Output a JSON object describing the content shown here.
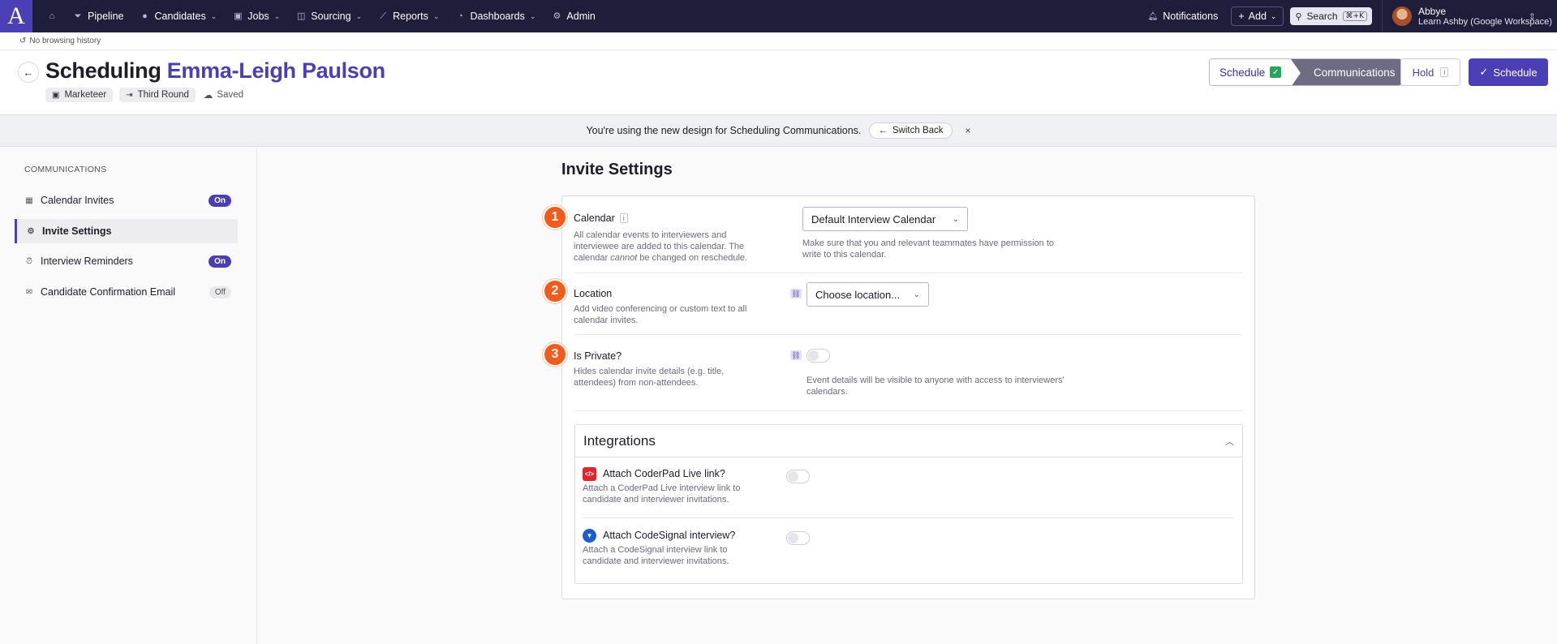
{
  "nav": {
    "logo": "A",
    "items": [
      {
        "label": "Pipeline",
        "chev": false
      },
      {
        "label": "Candidates",
        "chev": true
      },
      {
        "label": "Jobs",
        "chev": true
      },
      {
        "label": "Sourcing",
        "chev": true
      },
      {
        "label": "Reports",
        "chev": true
      },
      {
        "label": "Dashboards",
        "chev": true
      },
      {
        "label": "Admin",
        "chev": false
      }
    ],
    "notifications": "Notifications",
    "add": "Add",
    "search": "Search",
    "search_shortcut": "⌘+K",
    "user_name": "Abbye",
    "user_org": "Learn Ashby (Google Workspace)"
  },
  "history": "No browsing history",
  "header": {
    "title_prefix": "Scheduling",
    "candidate": "Emma-Leigh Paulson",
    "tag_job": "Marketeer",
    "tag_stage": "Third Round",
    "saved": "Saved",
    "step_schedule": "Schedule",
    "step_communications": "Communications",
    "hold": "Hold",
    "hold_info": "i",
    "schedule_button": "Schedule"
  },
  "banner": {
    "text": "You're using the new design for Scheduling Communications.",
    "switch_back": "Switch Back",
    "close": "×"
  },
  "sidebar": {
    "title": "COMMUNICATIONS",
    "items": [
      {
        "label": "Calendar Invites",
        "status": "On"
      },
      {
        "label": "Invite Settings",
        "status": ""
      },
      {
        "label": "Interview Reminders",
        "status": "On"
      },
      {
        "label": "Candidate Confirmation Email",
        "status": "Off"
      }
    ]
  },
  "main": {
    "title": "Invite Settings",
    "calendar": {
      "num": "1",
      "label": "Calendar",
      "info": "i",
      "desc_1": "All calendar events to interviewers and interviewee are added to this calendar. The calendar ",
      "desc_em": "cannot",
      "desc_2": " be changed on reschedule.",
      "value": "Default Interview Calendar",
      "hint": "Make sure that you and relevant teammates have permission to write to this calendar."
    },
    "location": {
      "num": "2",
      "label": "Location",
      "desc": "Add video conferencing or custom text to all calendar invites.",
      "placeholder": "Choose location..."
    },
    "private": {
      "num": "3",
      "label": "Is Private?",
      "desc": "Hides calendar invite details (e.g. title, attendees) from non-attendees.",
      "hint": "Event details will be visible to anyone with access to interviewers' calendars."
    },
    "integrations": {
      "title": "Integrations",
      "coderpad_label": "Attach CoderPad Live link?",
      "coderpad_desc": "Attach a CoderPad Live interview link to candidate and interviewer invitations.",
      "codesignal_label": "Attach CodeSignal interview?",
      "codesignal_desc": "Attach a CodeSignal interview link to candidate and interviewer invitations."
    }
  },
  "colors": {
    "brand": "#4b3fb5",
    "nav_bg": "#1e1d3a",
    "step_badge": "#f35b1b"
  }
}
